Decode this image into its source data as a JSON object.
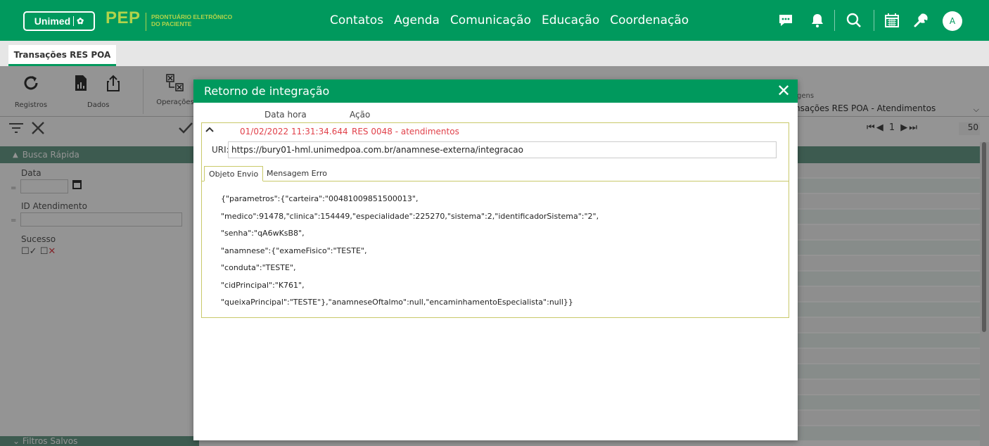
{
  "header": {
    "logo_text": "Unimed",
    "logo_mark": "✿",
    "brand": "PEP",
    "brand_sub_line1": "PRONTUÁRIO ELETRÔNICO",
    "brand_sub_line2": "DO PACIENTE",
    "nav": [
      "Contatos",
      "Agenda",
      "Comunicação",
      "Educação",
      "Coordenação"
    ],
    "icons": [
      "chat-icon",
      "bell-icon",
      "search-icon",
      "calendar-icon",
      "wrench-icon"
    ],
    "avatar_initial": "A"
  },
  "tabs": {
    "active": "Transações RES POA"
  },
  "toolbar": {
    "registros": "Registros",
    "dados": "Dados",
    "operacoes": "Operações",
    "right_label": "gens",
    "select_value": "nsações RES POA - Atendimentos"
  },
  "filterbar": {
    "page_current": "1",
    "page_size": "50"
  },
  "left_panel": {
    "busca_rapida": "Busca Rápida",
    "data_label": "Data",
    "id_label": "ID Atendimento",
    "sucesso_label": "Sucesso",
    "filtros_salvos": "Filtros Salvos",
    "eq": "="
  },
  "modal": {
    "title": "Retorno de integração",
    "col_datetime": "Data hora",
    "col_action": "Ação",
    "record": {
      "datetime": "01/02/2022 11:31:34.644",
      "action": "RES 0048 - atendimentos",
      "uri_label": "URI:",
      "uri": "https://bury01-hml.unimedpoa.com.br/anamnese-externa/integracao"
    },
    "tab_envio": "Objeto Envio",
    "tab_erro": "Mensagem Erro",
    "json_lines": [
      "{\"parametros\":{\"carteira\":\"00481009851500013\",",
      "\"medico\":91478,\"clinica\":154449,\"especialidade\":225270,\"sistema\":2,\"identificadorSistema\":\"2\",",
      "\"senha\":\"qA6wKsB8\",",
      "\"anamnese\":{\"exameFisico\":\"TESTE\",",
      "\"conduta\":\"TESTE\",",
      "\"cidPrincipal\":\"K761\",",
      "\"queixaPrincipal\":\"TESTE\"},\"anamneseOftalmo\":null,\"encaminhamentoEspecialista\":null}}"
    ]
  },
  "colors": {
    "brand_green": "#00995d",
    "accent_lime": "#b1d34b",
    "error_red": "#e1414a",
    "panel_header": "#6a9e8a"
  }
}
